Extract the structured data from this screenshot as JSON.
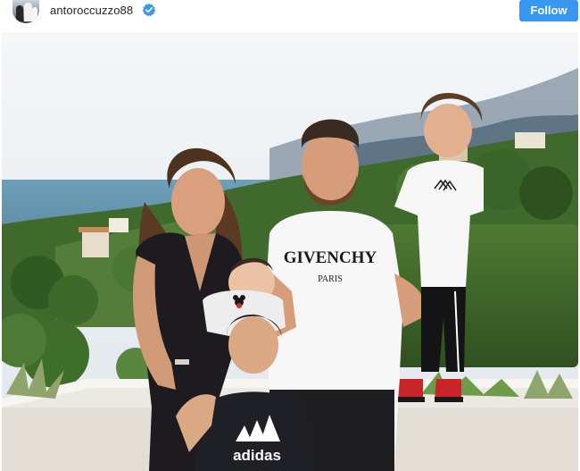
{
  "post": {
    "username": "antoroccuzzo88",
    "follow_label": "Follow",
    "verified": true,
    "photo_description_icons": [
      "verified-badge-icon"
    ]
  },
  "photo": {
    "shirt_brand_text": "GIVENCHY",
    "shirt_city_text": "PARIS",
    "kid_shirt_text": "adidas"
  },
  "colors": {
    "follow_button": "#3897f0",
    "verified_badge": "#3897f0",
    "username_text": "#262626"
  }
}
